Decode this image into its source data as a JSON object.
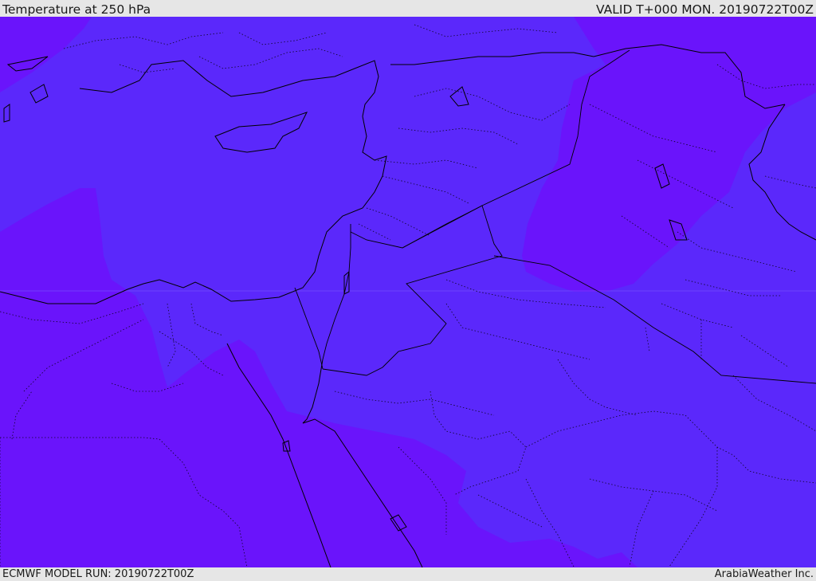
{
  "header": {
    "title": "Temperature at 250 hPa",
    "valid_time": "VALID T+000 MON. 20190722T00Z"
  },
  "footer": {
    "model_run": "ECMWF MODEL RUN: 20190722T00Z",
    "credit": "ArabiaWeather Inc."
  },
  "map": {
    "colors": {
      "warm_band": "#6a14fb",
      "cool_band": "#5b28fb",
      "border": "#000000",
      "background_bar": "#e6e6e6"
    }
  }
}
